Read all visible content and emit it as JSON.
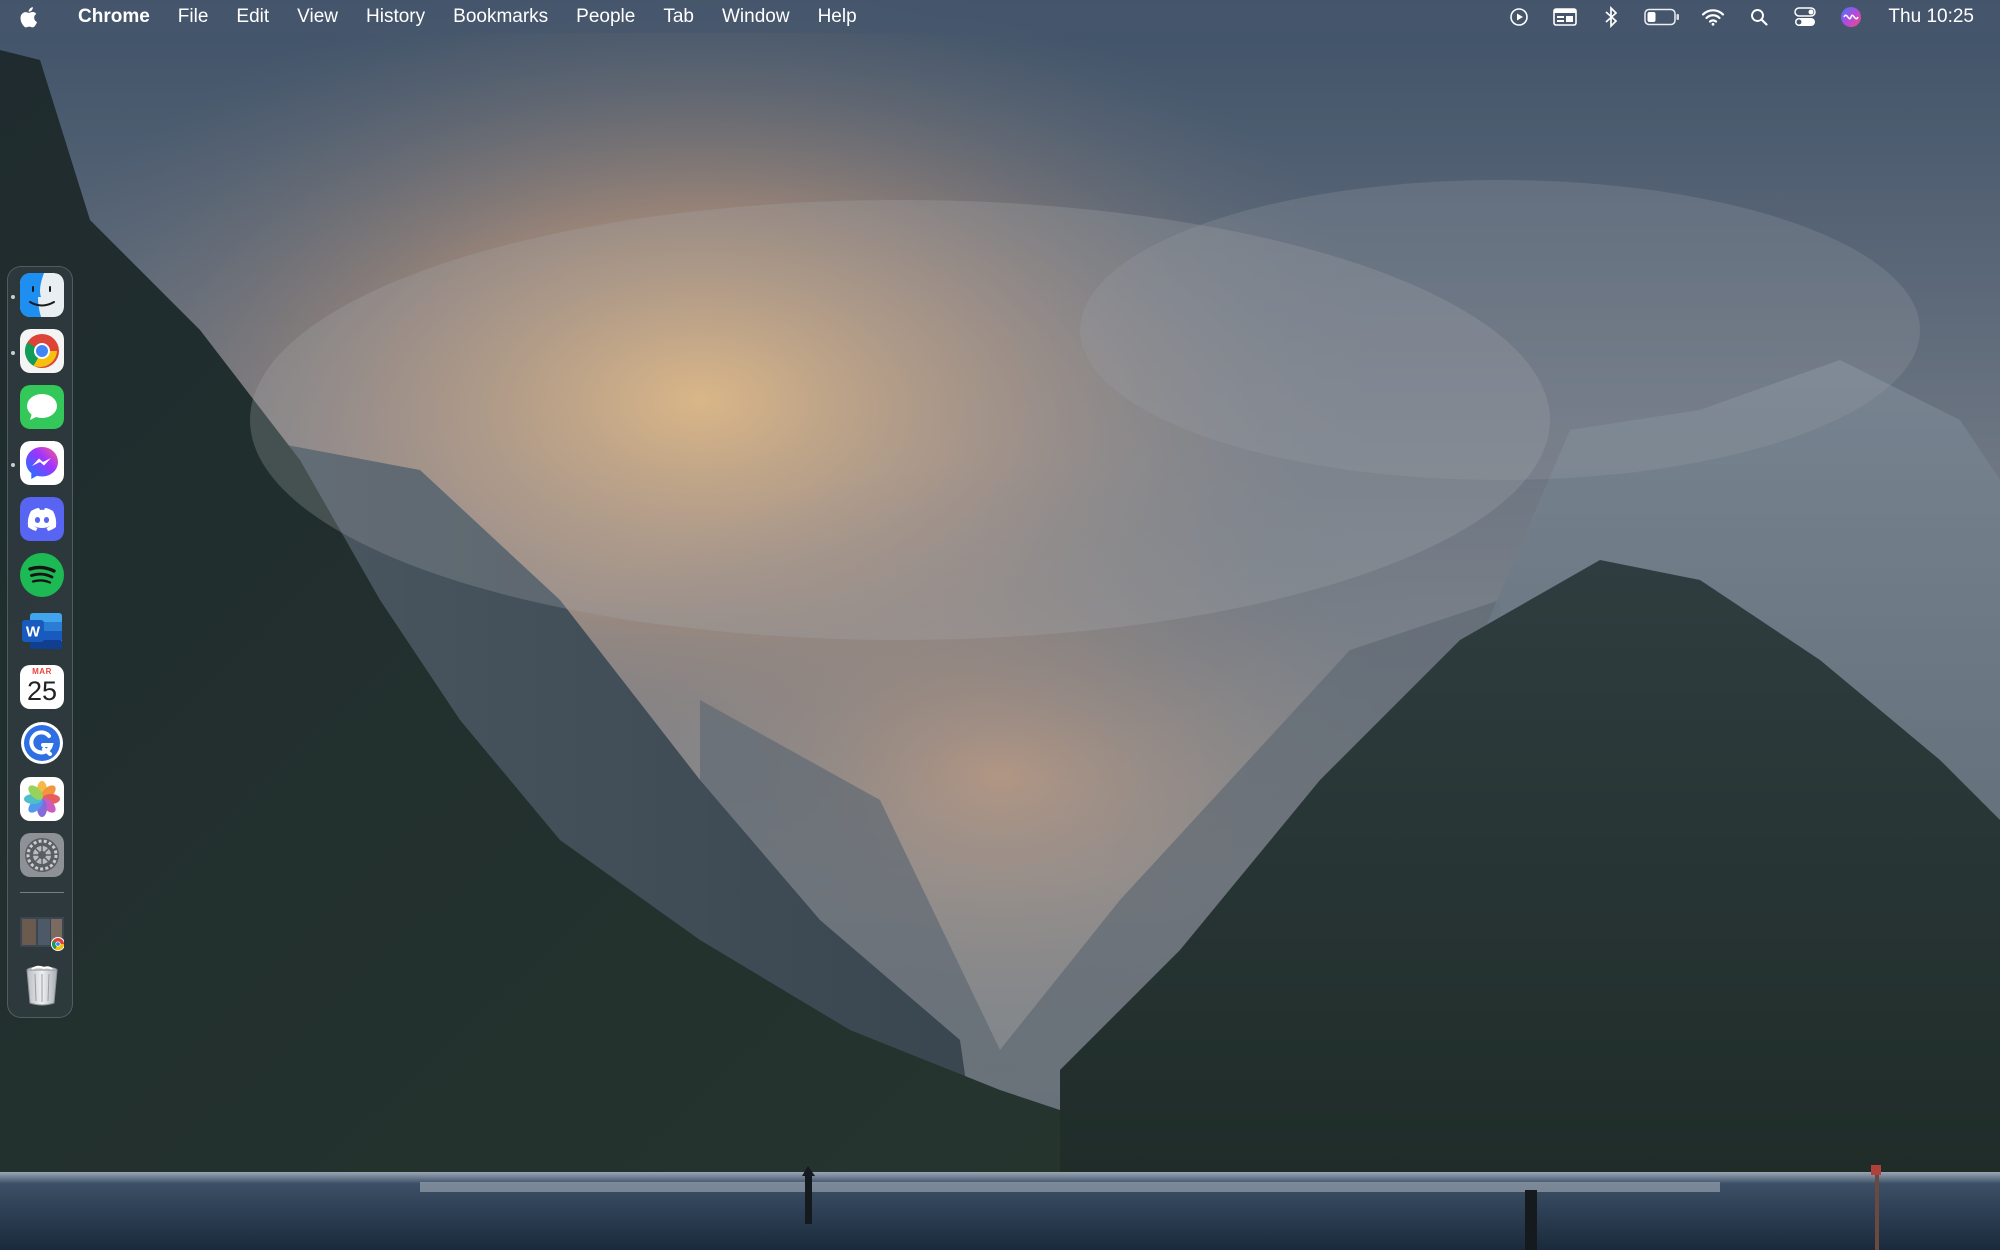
{
  "menubar": {
    "app_name": "Chrome",
    "menus": [
      "File",
      "Edit",
      "View",
      "History",
      "Bookmarks",
      "People",
      "Tab",
      "Window",
      "Help"
    ],
    "status_icons": [
      "screen-recording-icon",
      "keyboard-input-icon",
      "bluetooth-icon",
      "battery-icon",
      "wifi-icon",
      "spotlight-search-icon",
      "control-center-icon",
      "siri-icon"
    ],
    "clock": "Thu 10:25"
  },
  "dock": {
    "items": [
      {
        "name": "finder",
        "icon": "finder-icon",
        "running": true
      },
      {
        "name": "chrome",
        "icon": "chrome-icon",
        "running": true
      },
      {
        "name": "messages",
        "icon": "messages-icon",
        "running": false
      },
      {
        "name": "messenger",
        "icon": "messenger-icon",
        "running": true
      },
      {
        "name": "discord",
        "icon": "discord-icon",
        "running": false
      },
      {
        "name": "spotify",
        "icon": "spotify-icon",
        "running": false
      },
      {
        "name": "word",
        "icon": "word-icon",
        "running": false
      },
      {
        "name": "calendar",
        "icon": "calendar-icon",
        "running": false
      },
      {
        "name": "grammarly",
        "icon": "grammarly-icon",
        "running": false
      },
      {
        "name": "photos",
        "icon": "photos-icon",
        "running": false
      },
      {
        "name": "system-preferences",
        "icon": "gear-icon",
        "running": false
      },
      {
        "name": "minimized-chrome-window",
        "icon": "window-thumbnail-icon",
        "running": false
      },
      {
        "name": "trash",
        "icon": "trash-icon",
        "running": false
      }
    ],
    "calendar": {
      "month": "MAR",
      "day": "25"
    },
    "word_letter": "W"
  },
  "colors": {
    "menubar_bg": "#46566c",
    "messages_green": "#34c759",
    "spotify_green": "#1db954",
    "discord_blurple": "#5865f2",
    "word_blue": "#185abd"
  }
}
